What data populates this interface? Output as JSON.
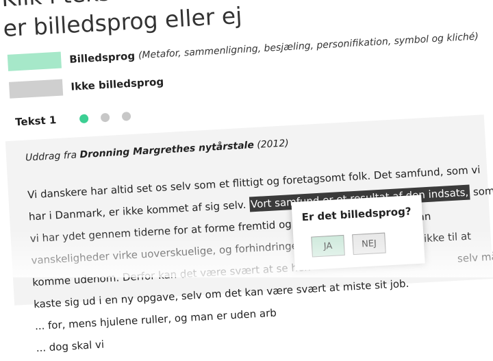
{
  "heading": {
    "line1": "Klik i teksten",
    "line2": "er billedsprog eller ej"
  },
  "legend": {
    "billedsprog_label": "Billedsprog",
    "billedsprog_desc": "(Metafor, sammenligning, besjæling, personifikation, symbol og kliché)",
    "ikke_label": "Ikke billedsprog",
    "colors": {
      "billedsprog": "#a6e8c9",
      "ikke": "#cfcfcf"
    }
  },
  "tabs": {
    "label": "Tekst 1",
    "dots": [
      "active",
      "inactive",
      "inactive"
    ]
  },
  "text_card": {
    "source_prefix": "Uddrag fra",
    "source_title": "Dronning Margrethes nytårstale",
    "source_year": "(2012)",
    "lines": [
      "Vi danskere har altid set os selv som et flittigt og foretagsomt folk. Det samfund, som vi",
      "har i Danmark, er ikke kommet af sig selv.",
      "Vort samfund er et resultat af den indsats,",
      "som",
      "vi har ydet gennem tiderne for at forme fremtid og fremskridt: I krisetider kan",
      "vanskeligheder virke uoverskuelige, og forhindringer føles som stopklodser, ikke til at",
      "komme udenom. Derfor kan det være svært at se hen",
      "selv må",
      "kaste sig ud i en ny opgave, selv om det kan være svært at miste sit job.",
      "... for, mens hjulene ruller, og man er uden arb",
      "... dog skal vi"
    ]
  },
  "popup": {
    "question": "Er det billedsprog?",
    "yes_label": "JA",
    "no_label": "NEJ"
  }
}
